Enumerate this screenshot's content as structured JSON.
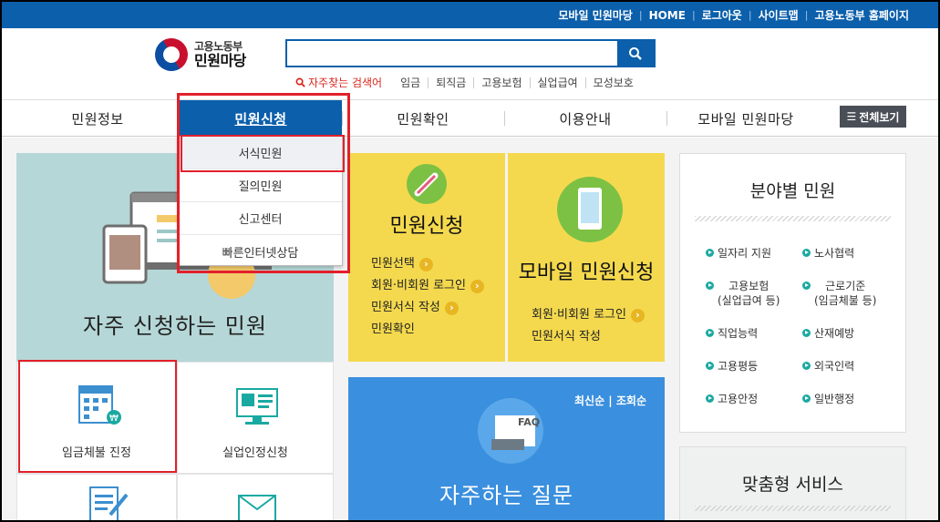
{
  "topbar": {
    "links": [
      "모바일 민원마당",
      "HOME",
      "로그아웃",
      "사이트맵",
      "고용노동부 홈페이지"
    ]
  },
  "logo": {
    "line1": "고용노동부",
    "line2": "민원마당"
  },
  "search": {
    "value": "",
    "placeholder": ""
  },
  "keywords": {
    "label": "자주찾는 검색어",
    "items": [
      "임금",
      "퇴직금",
      "고용보험",
      "실업급여",
      "모성보호"
    ]
  },
  "nav": {
    "items": [
      "민원정보",
      "민원신청",
      "민원확인",
      "이용안내",
      "모바일 민원마당"
    ],
    "active": "민원신청",
    "all_button": "전체보기"
  },
  "dropdown": {
    "items": [
      "서식민원",
      "질의민원",
      "신고센터",
      "빠른인터넷상담"
    ],
    "selected": "서식민원"
  },
  "frequent": {
    "title": "자주 신청하는 민원",
    "items": [
      "임금체불 진정",
      "실업인정신청"
    ]
  },
  "apply": {
    "title": "민원신청",
    "links": [
      "민원선택",
      "회원·비회원 로그인",
      "민원서식 작성",
      "민원확인"
    ]
  },
  "mobile_apply": {
    "title": "모바일 민원신청",
    "links": [
      "회원·비회원 로그인",
      "민원서식 작성"
    ]
  },
  "faq": {
    "title": "자주하는 질문",
    "sort_latest": "최신순",
    "sort_views": "조회순",
    "badge": "FAQ"
  },
  "field": {
    "title": "분야별 민원",
    "items": [
      "일자리 지원",
      "노사협력",
      "고용보험\n(실업급여 등)",
      "근로기준\n(임금체불 등)",
      "직업능력",
      "산재예방",
      "고용평등",
      "외국인력",
      "고용안정",
      "일반행정"
    ]
  },
  "service": {
    "title": "맞춤형 서비스"
  },
  "colors": {
    "primary": "#0b5fab",
    "highlight": "#e2202a",
    "yellow": "#f4d94e",
    "teal": "#b6d7d7",
    "faq_blue": "#3a8fde"
  }
}
